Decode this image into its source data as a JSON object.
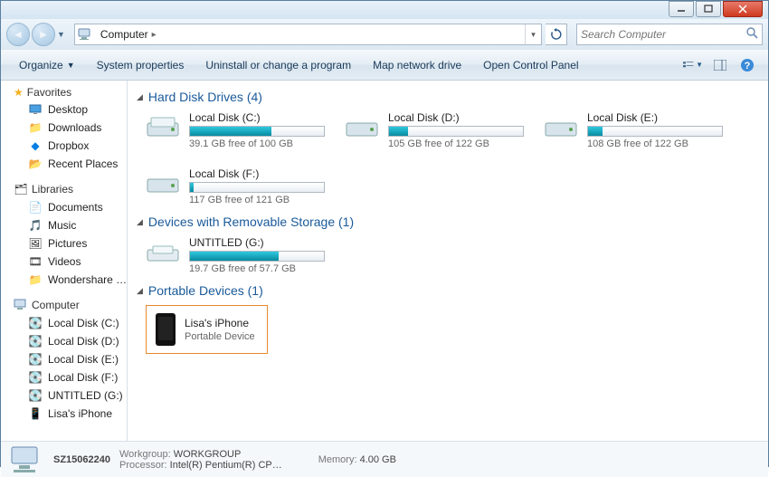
{
  "breadcrumb": {
    "root": "Computer"
  },
  "search": {
    "placeholder": "Search Computer"
  },
  "toolbar": {
    "organize": "Organize",
    "sysprops": "System properties",
    "uninstall": "Uninstall or change a program",
    "mapdrive": "Map network drive",
    "controlpanel": "Open Control Panel"
  },
  "sidebar": {
    "favorites": {
      "head": "Favorites",
      "items": [
        "Desktop",
        "Downloads",
        "Dropbox",
        "Recent Places"
      ]
    },
    "libraries": {
      "head": "Libraries",
      "items": [
        "Documents",
        "Music",
        "Pictures",
        "Videos",
        "Wondershare …"
      ]
    },
    "computer": {
      "head": "Computer",
      "items": [
        "Local Disk (C:)",
        "Local Disk (D:)",
        "Local Disk (E:)",
        "Local Disk (F:)",
        "UNTITLED (G:)",
        "Lisa's iPhone"
      ]
    }
  },
  "sections": {
    "hdd": {
      "title": "Hard Disk Drives (4)"
    },
    "removable": {
      "title": "Devices with Removable Storage (1)"
    },
    "portable": {
      "title": "Portable Devices (1)"
    }
  },
  "drives": {
    "c": {
      "name": "Local Disk (C:)",
      "free": "39.1 GB free of 100 GB",
      "used_pct": 61
    },
    "d": {
      "name": "Local Disk (D:)",
      "free": "105 GB free of 122 GB",
      "used_pct": 14
    },
    "e": {
      "name": "Local Disk (E:)",
      "free": "108 GB free of 122 GB",
      "used_pct": 11
    },
    "f": {
      "name": "Local Disk (F:)",
      "free": "117 GB free of 121 GB",
      "used_pct": 3
    },
    "g": {
      "name": "UNTITLED (G:)",
      "free": "19.7 GB free of 57.7 GB",
      "used_pct": 66
    }
  },
  "portable_device": {
    "name": "Lisa's iPhone",
    "type": "Portable Device"
  },
  "status": {
    "computer_name": "SZ15062240",
    "workgroup_label": "Workgroup:",
    "workgroup": "WORKGROUP",
    "processor_label": "Processor:",
    "processor": "Intel(R) Pentium(R) CP…",
    "memory_label": "Memory:",
    "memory": "4.00 GB"
  }
}
